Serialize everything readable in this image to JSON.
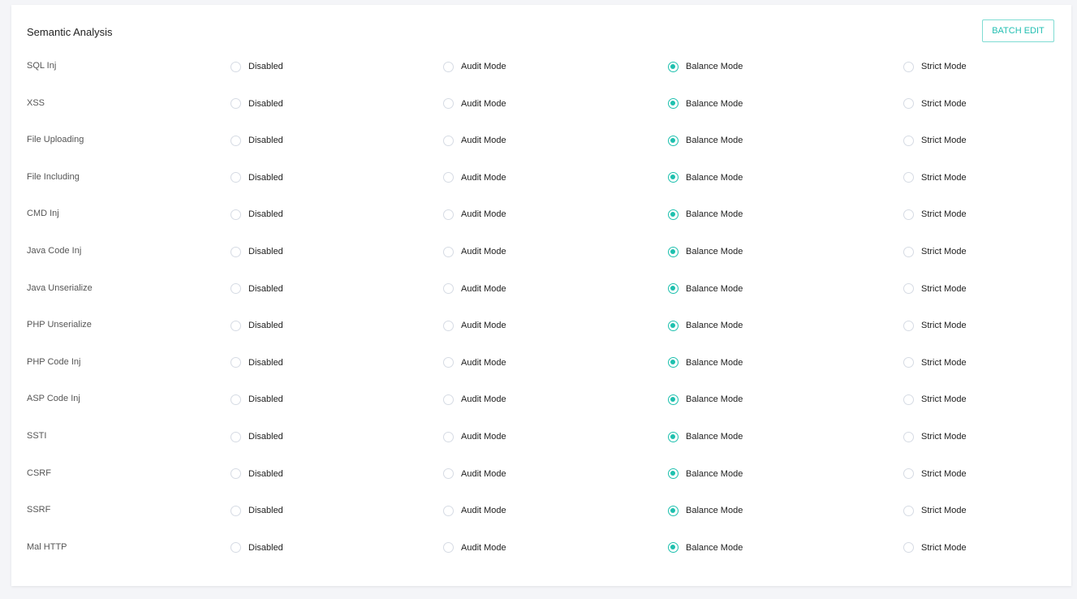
{
  "title": "Semantic Analysis",
  "batch_edit_label": "BATCH EDIT",
  "accent_color": "#1ec0ae",
  "options": [
    "Disabled",
    "Audit Mode",
    "Balance Mode",
    "Strict Mode"
  ],
  "rows": [
    {
      "label": "SQL Inj",
      "selected": "Balance Mode"
    },
    {
      "label": "XSS",
      "selected": "Balance Mode"
    },
    {
      "label": "File Uploading",
      "selected": "Balance Mode"
    },
    {
      "label": "File Including",
      "selected": "Balance Mode"
    },
    {
      "label": "CMD Inj",
      "selected": "Balance Mode"
    },
    {
      "label": "Java Code Inj",
      "selected": "Balance Mode"
    },
    {
      "label": "Java Unserialize",
      "selected": "Balance Mode"
    },
    {
      "label": "PHP Unserialize",
      "selected": "Balance Mode"
    },
    {
      "label": "PHP Code Inj",
      "selected": "Balance Mode"
    },
    {
      "label": "ASP Code Inj",
      "selected": "Balance Mode"
    },
    {
      "label": "SSTI",
      "selected": "Balance Mode"
    },
    {
      "label": "CSRF",
      "selected": "Balance Mode"
    },
    {
      "label": "SSRF",
      "selected": "Balance Mode"
    },
    {
      "label": "Mal HTTP",
      "selected": "Balance Mode"
    }
  ]
}
